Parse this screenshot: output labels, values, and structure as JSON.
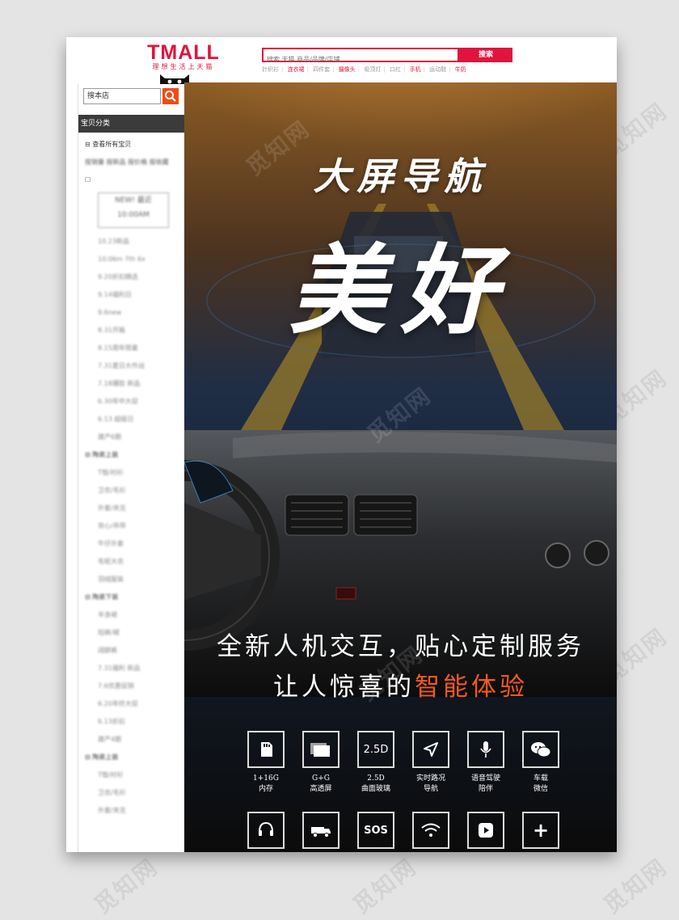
{
  "header": {
    "logo_main": "TMALL",
    "logo_sub": "理想生活上天猫",
    "search_placeholder": "搜索 天猫 商品/品牌/店铺",
    "search_button": "搜索",
    "hot_links": [
      "针织衫",
      "连衣裙",
      "四件套",
      "摄像头",
      "吸顶灯",
      "口红",
      "手机",
      "运动鞋",
      "牛奶"
    ]
  },
  "sidebar": {
    "search_value": "搜本店",
    "category_title": "宝贝分类",
    "view_all": "查看所有宝贝",
    "sort_links": "按销量 按新品 按价格 按收藏",
    "new_badge": "NEW! 最近 10:00AM",
    "items_1": [
      "10.23新品",
      "10.06m 7th 6x",
      "9.20折扣精选",
      "9.14福利日",
      "9.6new",
      "8.31开箱",
      "8.15周年限量",
      "7.31夏日大作战",
      "7.18爆款 新品",
      "6.30年中大促",
      "6.13 超级日",
      "建产6期"
    ],
    "group_2": "陶瓷上装",
    "items_2": [
      "T恤/衬衫",
      "卫衣/毛衫",
      "外套/夹克",
      "背心/吊带",
      "牛仔外套",
      "毛呢大衣",
      "羽绒服装"
    ],
    "group_3": "陶瓷下装",
    "items_3": [
      "半身裙",
      "短裤/裙",
      "阔腿裤"
    ],
    "items_4": [
      "7.31福利 新品",
      "7.6优惠促销",
      "6.20年终大促",
      "6.13折扣",
      "建产4期"
    ],
    "group_5": "陶瓷上装",
    "items_5": [
      "T恤/衬衫",
      "卫衣/毛衫",
      "外套/夹克"
    ]
  },
  "hero": {
    "title_small": "大屏导航",
    "title_big": "美好",
    "tagline_1": "全新人机交互，贴心定制服务",
    "tagline_2_prefix": "让人惊喜的",
    "tagline_2_accent": "智能体验",
    "accent_color": "#f15a22",
    "features_row1": [
      {
        "icon": "sd-card-icon",
        "label_1": "1+16G",
        "label_2": "内存"
      },
      {
        "icon": "screens-icon",
        "label_1": "G+G",
        "label_2": "高透屏"
      },
      {
        "icon": "2.5d-text-icon",
        "text": "2.5D",
        "label_1": "2.5D",
        "label_2": "曲面玻璃"
      },
      {
        "icon": "navigation-arrow-icon",
        "label_1": "实时路况",
        "label_2": "导航"
      },
      {
        "icon": "microphone-icon",
        "label_1": "语音驾驶",
        "label_2": "陪伴"
      },
      {
        "icon": "wechat-icon",
        "label_1": "车载",
        "label_2": "微信"
      }
    ],
    "features_row2": [
      {
        "icon": "headset-icon"
      },
      {
        "icon": "tow-truck-icon"
      },
      {
        "icon": "sos-icon",
        "text": "SOS"
      },
      {
        "icon": "wifi-icon"
      },
      {
        "icon": "play-icon"
      },
      {
        "icon": "plus-icon",
        "text": "+"
      }
    ]
  },
  "watermark": "觅知网"
}
